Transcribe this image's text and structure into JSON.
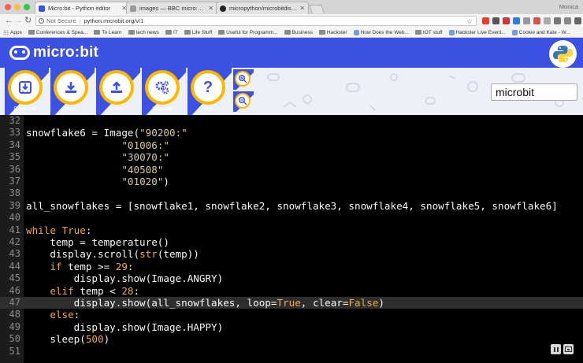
{
  "browser": {
    "tabs": [
      {
        "title": "Micro:bit - Python editor",
        "favicon_color": "#3c50e2",
        "active": true
      },
      {
        "title": "images — BBC micro:bit Micr",
        "favicon_color": "#9a9a9a",
        "active": false
      },
      {
        "title": "micropython/microbitdisplay.c",
        "favicon_color": "#222222",
        "active": false
      }
    ],
    "profile": "Monica",
    "omnibox": {
      "security": "Not Secure",
      "url": "python.microbit.org/v/1"
    },
    "bookmarks": [
      {
        "label": "Apps",
        "kind": "apps"
      },
      {
        "label": "Conferences & Spea...",
        "kind": "folder"
      },
      {
        "label": "To Learn",
        "kind": "folder"
      },
      {
        "label": "tech news",
        "kind": "folder"
      },
      {
        "label": "IT",
        "kind": "folder"
      },
      {
        "label": "Life Stuff",
        "kind": "folder"
      },
      {
        "label": "Useful for Programm...",
        "kind": "folder"
      },
      {
        "label": "Business",
        "kind": "folder"
      },
      {
        "label": "Hackster",
        "kind": "folder"
      },
      {
        "label": "How Does the Web...",
        "kind": "site"
      },
      {
        "label": "IOT stuff",
        "kind": "folder"
      },
      {
        "label": "Hackster Live Event...",
        "kind": "site"
      },
      {
        "label": "Cookie and Kate - W...",
        "kind": "site"
      }
    ]
  },
  "header": {
    "logo_text": "micro:bit"
  },
  "toolbar": {
    "buttons": [
      {
        "label": "Download",
        "icon": "download-icon"
      },
      {
        "label": "Save",
        "icon": "save-icon"
      },
      {
        "label": "Load",
        "icon": "load-icon"
      },
      {
        "label": "Snippets",
        "icon": "gears-icon"
      },
      {
        "label": "Help",
        "icon": "help-icon"
      }
    ],
    "script_name": "microbit"
  },
  "editor": {
    "active_line": 47,
    "lines": [
      {
        "n": "32",
        "tokens": []
      },
      {
        "n": "33",
        "tokens": [
          [
            "name",
            "snowflake6 "
          ],
          [
            "op",
            "= "
          ],
          [
            "name",
            "Image("
          ],
          [
            "str",
            "\"90200:\""
          ]
        ]
      },
      {
        "n": "34",
        "tokens": [
          [
            "name",
            "                "
          ],
          [
            "str",
            "\"01006:\""
          ]
        ]
      },
      {
        "n": "35",
        "tokens": [
          [
            "name",
            "                "
          ],
          [
            "str",
            "\"30070:\""
          ]
        ]
      },
      {
        "n": "36",
        "tokens": [
          [
            "name",
            "                "
          ],
          [
            "str",
            "\"40508\""
          ]
        ]
      },
      {
        "n": "37",
        "tokens": [
          [
            "name",
            "                "
          ],
          [
            "str",
            "\"01020\""
          ],
          [
            "name",
            ")"
          ]
        ]
      },
      {
        "n": "38",
        "tokens": []
      },
      {
        "n": "39",
        "tokens": [
          [
            "name",
            "all_snowflakes = [snowflake1, snowflake2, snowflake3, snowflake4, snowflake5, snowflake6]"
          ]
        ]
      },
      {
        "n": "40",
        "tokens": []
      },
      {
        "n": "41",
        "tokens": [
          [
            "kw",
            "while "
          ],
          [
            "num",
            "True"
          ],
          [
            "name",
            ":"
          ]
        ]
      },
      {
        "n": "42",
        "tokens": [
          [
            "name",
            "    temp = temperature()"
          ]
        ]
      },
      {
        "n": "43",
        "tokens": [
          [
            "name",
            "    display.scroll("
          ],
          [
            "builtin",
            "str"
          ],
          [
            "name",
            "(temp))"
          ]
        ]
      },
      {
        "n": "44",
        "tokens": [
          [
            "kw",
            "    if "
          ],
          [
            "name",
            "temp >= "
          ],
          [
            "num",
            "29"
          ],
          [
            "name",
            ":"
          ]
        ]
      },
      {
        "n": "45",
        "tokens": [
          [
            "name",
            "        display.show(Image.ANGRY)"
          ]
        ]
      },
      {
        "n": "46",
        "tokens": [
          [
            "kw",
            "    elif "
          ],
          [
            "name",
            "temp < "
          ],
          [
            "num",
            "28"
          ],
          [
            "name",
            ":"
          ]
        ]
      },
      {
        "n": "47",
        "tokens": [
          [
            "name",
            "        display.show(all_snowflakes, loop="
          ],
          [
            "num",
            "True"
          ],
          [
            "name",
            ", clear="
          ],
          [
            "num",
            "False"
          ],
          [
            "name",
            ")"
          ]
        ]
      },
      {
        "n": "48",
        "tokens": [
          [
            "kw",
            "    else"
          ],
          [
            "name",
            ":"
          ]
        ]
      },
      {
        "n": "49",
        "tokens": [
          [
            "name",
            "        display.show(Image.HAPPY)"
          ]
        ]
      },
      {
        "n": "50",
        "tokens": [
          [
            "name",
            "    sleep("
          ],
          [
            "num",
            "500"
          ],
          [
            "name",
            ")"
          ]
        ]
      },
      {
        "n": "51",
        "tokens": []
      }
    ]
  }
}
